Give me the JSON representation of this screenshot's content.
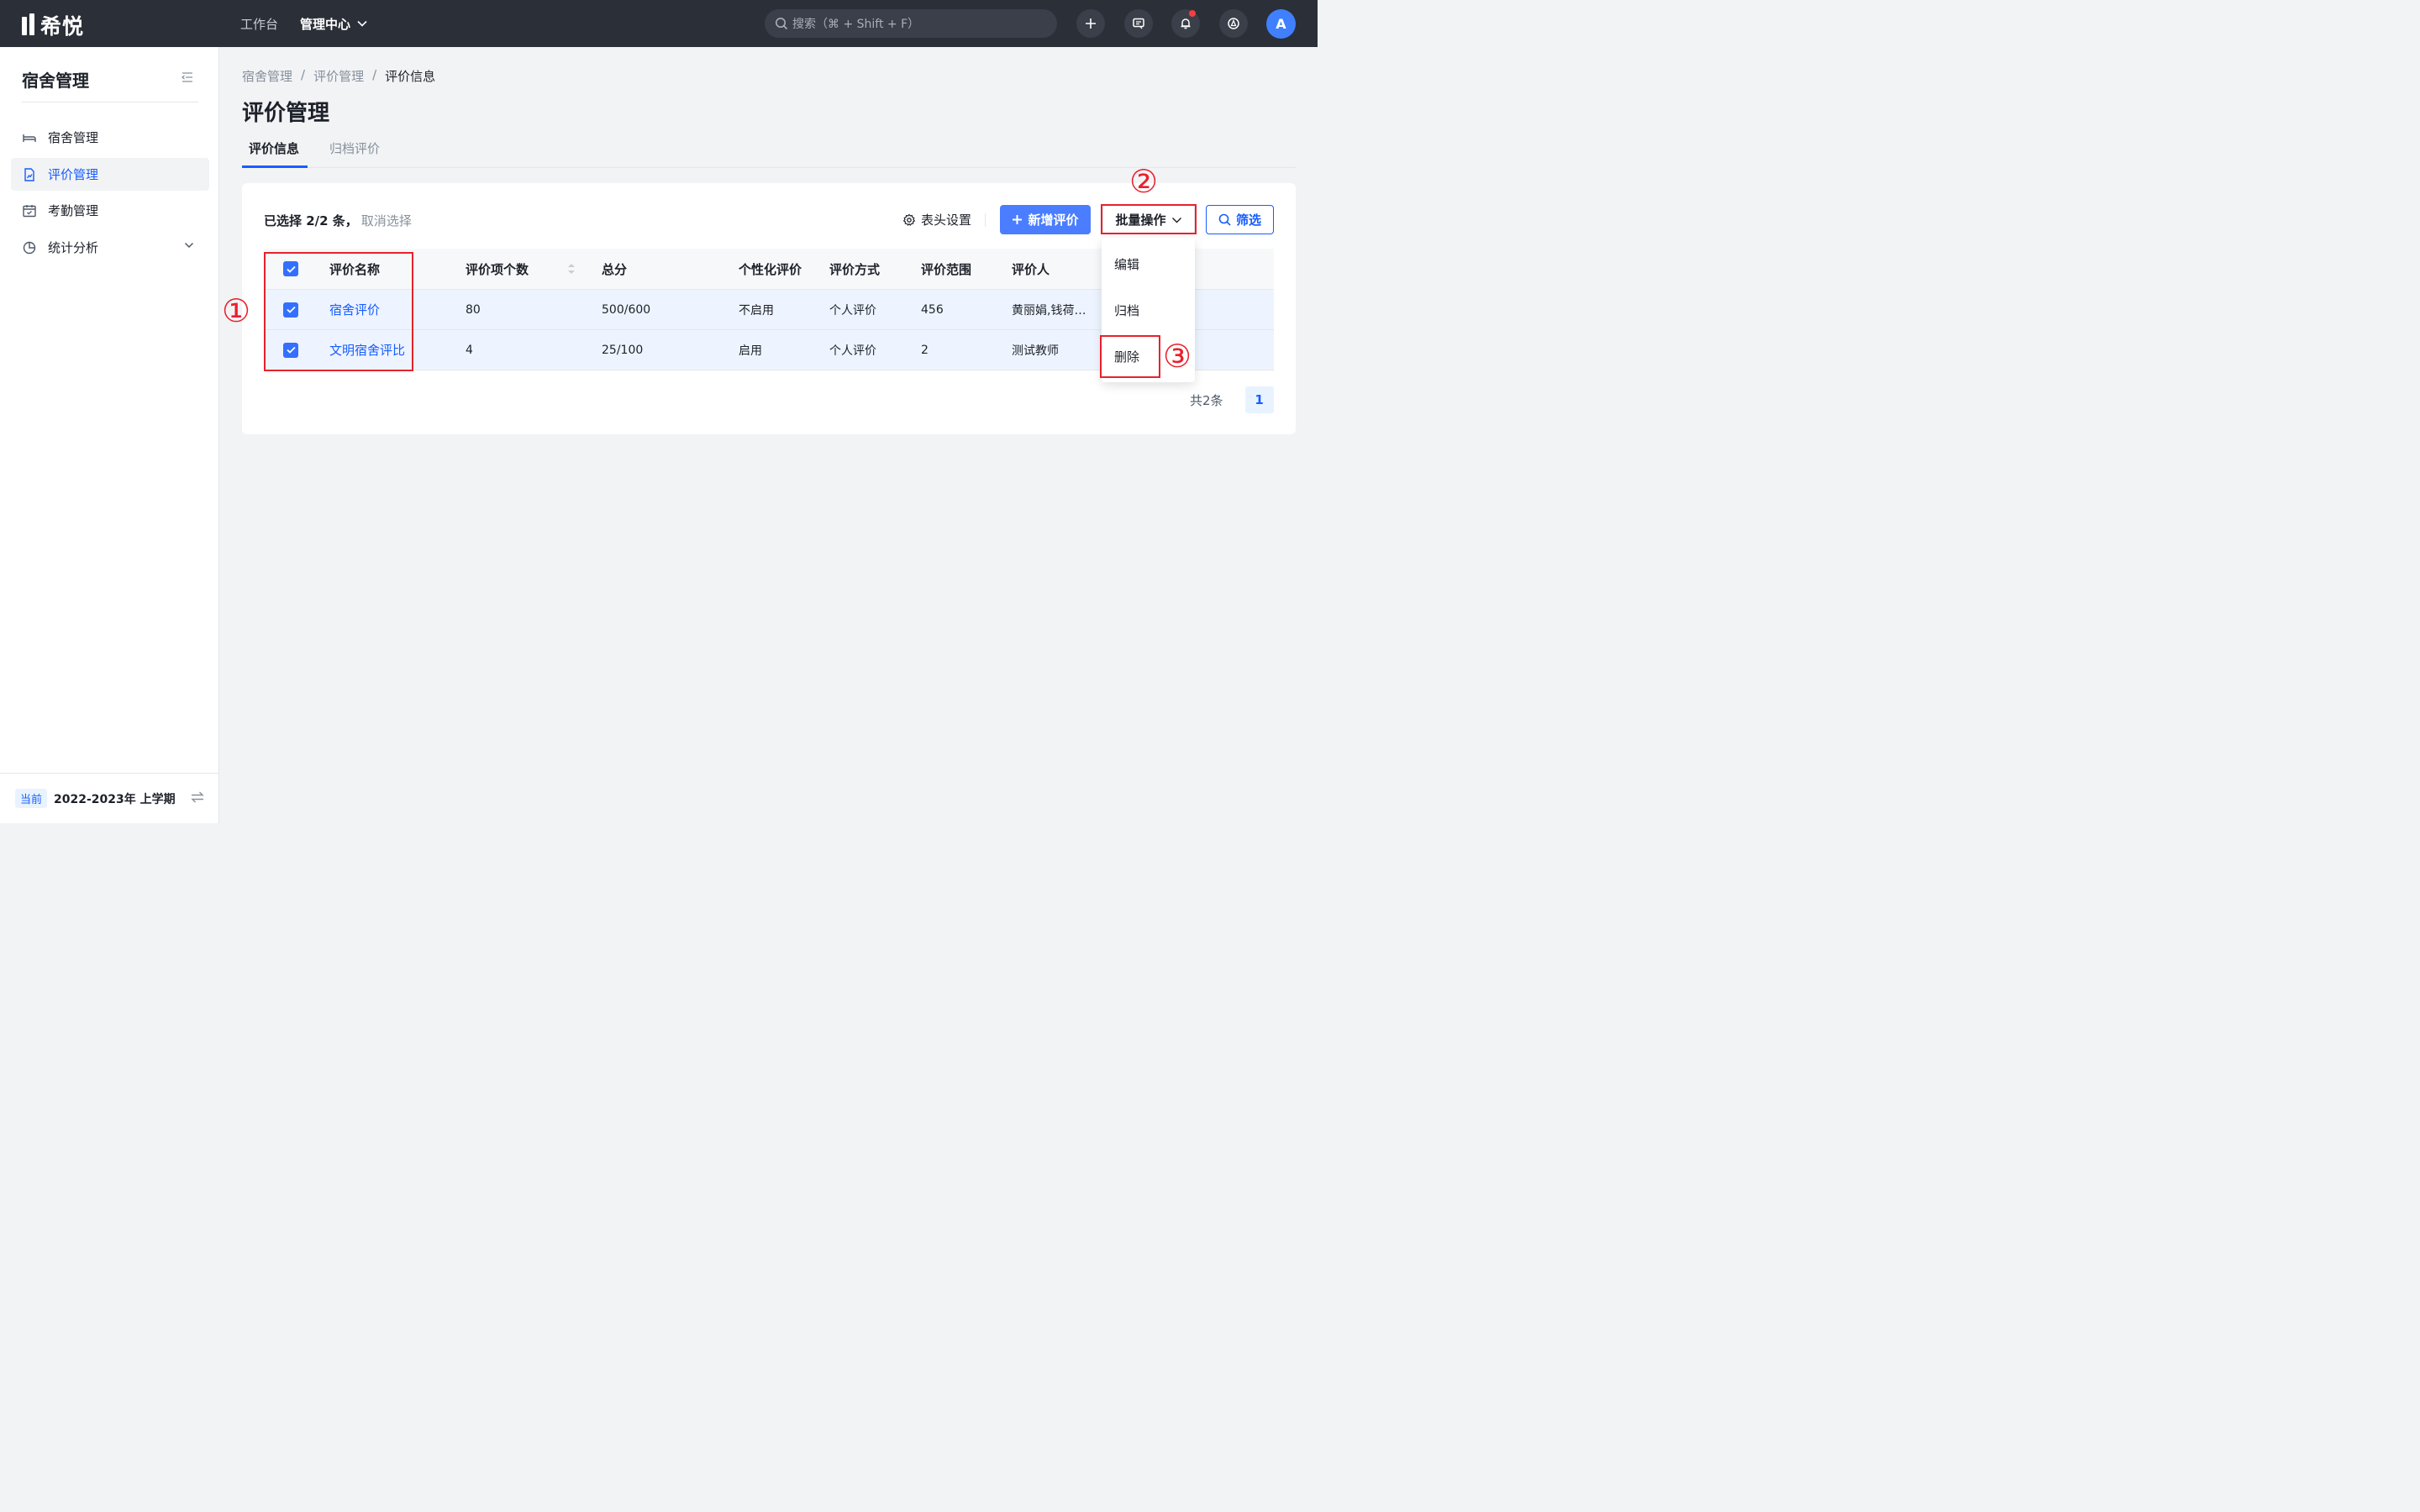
{
  "app": {
    "logo_text": "希悦"
  },
  "topnav": {
    "workbench": "工作台",
    "admin_center": "管理中心"
  },
  "search": {
    "placeholder": "搜索（⌘ + Shift + F）"
  },
  "user": {
    "avatar_letter": "A"
  },
  "sidebar": {
    "title": "宿舍管理",
    "items": [
      {
        "label": "宿舍管理",
        "icon": "bed-icon"
      },
      {
        "label": "评价管理",
        "icon": "chart-doc-icon",
        "active": true
      },
      {
        "label": "考勤管理",
        "icon": "calendar-icon"
      },
      {
        "label": "统计分析",
        "icon": "pie-chart-icon",
        "expandable": true
      }
    ],
    "footer": {
      "tag": "当前",
      "term": "2022-2023年 上学期"
    }
  },
  "breadcrumb": [
    "宿舍管理",
    "/",
    "评价管理",
    "/",
    "评价信息"
  ],
  "page_title": "评价管理",
  "tabs": [
    {
      "label": "评价信息",
      "active": true
    },
    {
      "label": "归档评价"
    }
  ],
  "toolbar": {
    "selection_text": "已选择 2/2 条，",
    "cancel_selection": "取消选择",
    "column_settings": "表头设置",
    "add_button": "新增评价",
    "batch_button": "批量操作",
    "filter_button": "筛选"
  },
  "table": {
    "headers": [
      "评价名称",
      "评价项个数",
      "总分",
      "个性化评价",
      "评价方式",
      "评价范围",
      "评价人"
    ],
    "rows": [
      {
        "name": "宿舍评价",
        "items": "80",
        "score": "500/600",
        "personal": "不启用",
        "method": "个人评价",
        "scope": "456",
        "evaluator": "黄丽娟,钱荷…"
      },
      {
        "name": "文明宿舍评比",
        "items": "4",
        "score": "25/100",
        "personal": "启用",
        "method": "个人评价",
        "scope": "2",
        "evaluator": "测试教师"
      }
    ]
  },
  "pagination": {
    "total": "共2条",
    "current": "1"
  },
  "batch_menu": [
    "编辑",
    "归档",
    "删除"
  ],
  "annotations": [
    "①",
    "②",
    "③"
  ],
  "colors": {
    "primary": "#165dff",
    "topbar": "#2b2f38",
    "annotation": "#e8212c"
  }
}
